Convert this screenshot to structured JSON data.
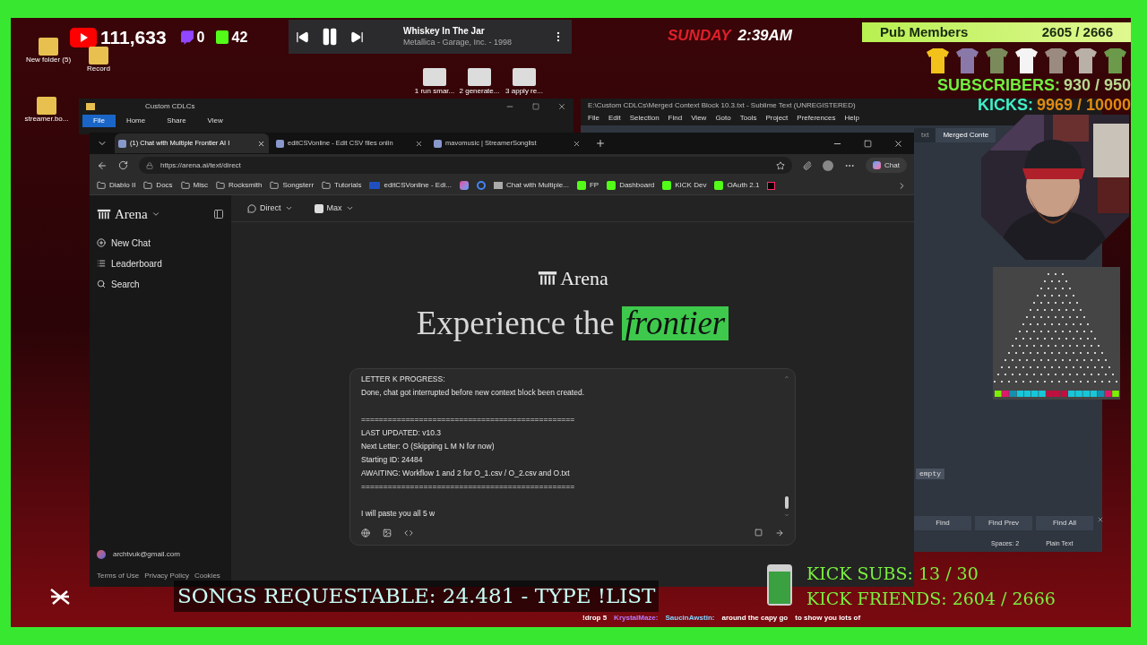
{
  "overlay": {
    "youtube": "111,633",
    "twitch": "0",
    "kick": "42",
    "player": {
      "title": "Whiskey In The Jar",
      "subtitle": "Metallica - Garage, Inc. - 1998"
    },
    "clock": {
      "day": "SUNDAY",
      "time": "2:39AM"
    },
    "pub_members": {
      "label": "Pub Members",
      "count": "2605 / 2666"
    },
    "subscribers": {
      "label": "SUBSCRIBERS:",
      "count": "930 / 950"
    },
    "kicks": {
      "label": "KICKS:",
      "count": "9969 / 10000"
    },
    "songs_banner": "SONGS REQUESTABLE: 24.481 - TYPE !LIST",
    "kick_subs": "KICK SUBS: 13 / 30",
    "kick_friends": "KICK FRIENDS: 2604 / 2666",
    "chat_ticker": [
      {
        "kind": "message",
        "text": "!drop 5"
      },
      {
        "kind": "user",
        "text": "KrystalMaze:",
        "color": "#b57cff"
      },
      {
        "kind": "user",
        "text": "SaucinAwstin:",
        "color": "#7fd4ff"
      },
      {
        "kind": "message",
        "text": "around the capy go"
      },
      {
        "kind": "message",
        "text": "to show you lots of"
      }
    ]
  },
  "desktop": {
    "icons": [
      {
        "label": "New folder (5)"
      },
      {
        "label": "Record"
      },
      {
        "label": "streamer.bo..."
      }
    ],
    "shortcuts": [
      {
        "label": "1 run smar..."
      },
      {
        "label": "2 generate..."
      },
      {
        "label": "3 apply re..."
      }
    ]
  },
  "explorer": {
    "title": "Custom CDLCs",
    "ribbon_tabs": [
      {
        "label": "File",
        "selected": true
      },
      {
        "label": "Home",
        "selected": false
      },
      {
        "label": "Share",
        "selected": false
      },
      {
        "label": "View",
        "selected": false
      }
    ]
  },
  "sublime": {
    "title": "E:\\Custom CDLCs\\Merged Context Block 10.3.txt - Sublime Text (UNREGISTERED)",
    "menu": [
      "File",
      "Edit",
      "Selection",
      "Find",
      "View",
      "Goto",
      "Tools",
      "Project",
      "Preferences",
      "Help"
    ],
    "tabs": [
      {
        "title": "txt",
        "selected": false
      },
      {
        "title": "Merged Conte",
        "selected": true
      }
    ],
    "editor_text": "empty",
    "find_buttons": [
      "Find",
      "Find Prev",
      "Find All"
    ],
    "status": [
      "Spaces: 2",
      "Plain Text"
    ]
  },
  "browser": {
    "tabs": [
      {
        "title": "(1) Chat with Multiple Frontier AI I",
        "selected": true
      },
      {
        "title": "editCSVonline - Edit CSV files onlin",
        "selected": false
      },
      {
        "title": "mavomusic | StreamerSonglist",
        "selected": false
      }
    ],
    "url": "https://arena.ai/text/direct",
    "chat_button": "Chat",
    "bookmarks": [
      {
        "kind": "folder",
        "label": "Diablo II"
      },
      {
        "kind": "folder",
        "label": "Docs"
      },
      {
        "kind": "folder",
        "label": "Misc"
      },
      {
        "kind": "folder",
        "label": "Rocksmith"
      },
      {
        "kind": "folder",
        "label": "Songsterr"
      },
      {
        "kind": "folder",
        "label": "Tutorials"
      },
      {
        "kind": "csv",
        "label": "editCSVonline - Edi..."
      },
      {
        "kind": "arena",
        "label": "Chat with Multiple..."
      },
      {
        "kind": "kick",
        "label": "FP"
      },
      {
        "kind": "kick",
        "label": "Dashboard"
      },
      {
        "kind": "kick",
        "label": "KICK Dev"
      },
      {
        "kind": "kick",
        "label": "OAuth 2.1"
      }
    ]
  },
  "arena": {
    "brand": "Arena",
    "nav": [
      {
        "label": "New Chat",
        "kind": "new"
      },
      {
        "label": "Leaderboard",
        "kind": "board"
      },
      {
        "label": "Search",
        "kind": "search"
      }
    ],
    "user_email": "archtvuk@gmail.com",
    "footer_links": [
      "Terms of Use",
      "Privacy Policy",
      "Cookies"
    ],
    "mode": "Direct",
    "model": "Max",
    "hero_logo": "Arena",
    "heading": "Experience the",
    "heading_highlight": "frontier",
    "prompt_paragraphs": [
      [
        "LETTER K PROGRESS:",
        "Done, chat got interrupted before new context block been created."
      ],
      [
        "================================================",
        "LAST UPDATED: v10.3",
        "Next Letter: O (Skipping L M N for now)",
        "Starting ID: 24484",
        "AWAITING: Workflow 1 and 2 for O_1.csv / O_2.csv and O.txt",
        "================================================"
      ],
      [
        "I will paste you all 5 w"
      ]
    ]
  }
}
